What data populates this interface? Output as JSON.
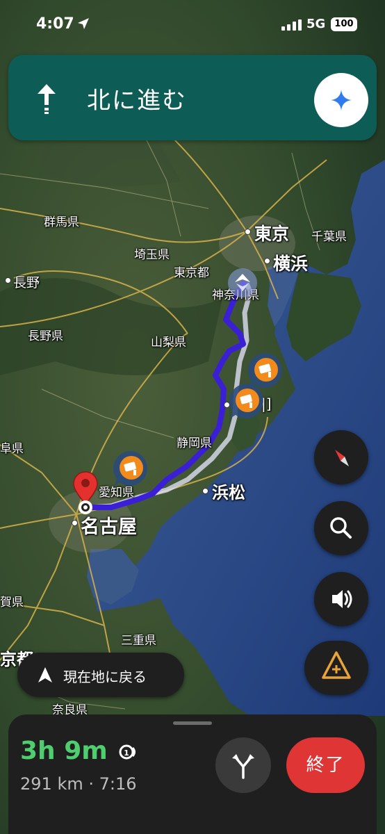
{
  "status_bar": {
    "time": "4:07",
    "network": "5G",
    "battery": "100"
  },
  "nav": {
    "instruction": "北に進む"
  },
  "map_labels": {
    "tokyo": "東京",
    "chiba": "千葉県",
    "gunma": "群馬県",
    "saitama": "埼玉県",
    "yokohama": "横浜",
    "tokyo_to": "東京都",
    "kanagawa": "神奈川県",
    "nagano_city": "長野",
    "nagano_pref": "長野県",
    "yamanashi": "山梨県",
    "shizuoka": "静岡県",
    "aichi": "愛知県",
    "hamamatsu": "浜松",
    "nagoya": "名古屋",
    "gifu_partial": "阜県",
    "shiga_partial": "賀県",
    "mie": "三重県",
    "kyoto_partial": "京都",
    "nara": "奈良県",
    "cut_label": "|]"
  },
  "recenter": {
    "label": "現在地に戻る"
  },
  "trip": {
    "eta": "3h 9m",
    "detail": "291 km · 7:16",
    "end_label": "終了"
  },
  "colors": {
    "banner": "#0d5c55",
    "route": "#3a1fd6",
    "eta_green": "#4fce6f",
    "end_red": "#e03535",
    "hazard": "#e8a33a",
    "camera": "#f28a1c"
  }
}
